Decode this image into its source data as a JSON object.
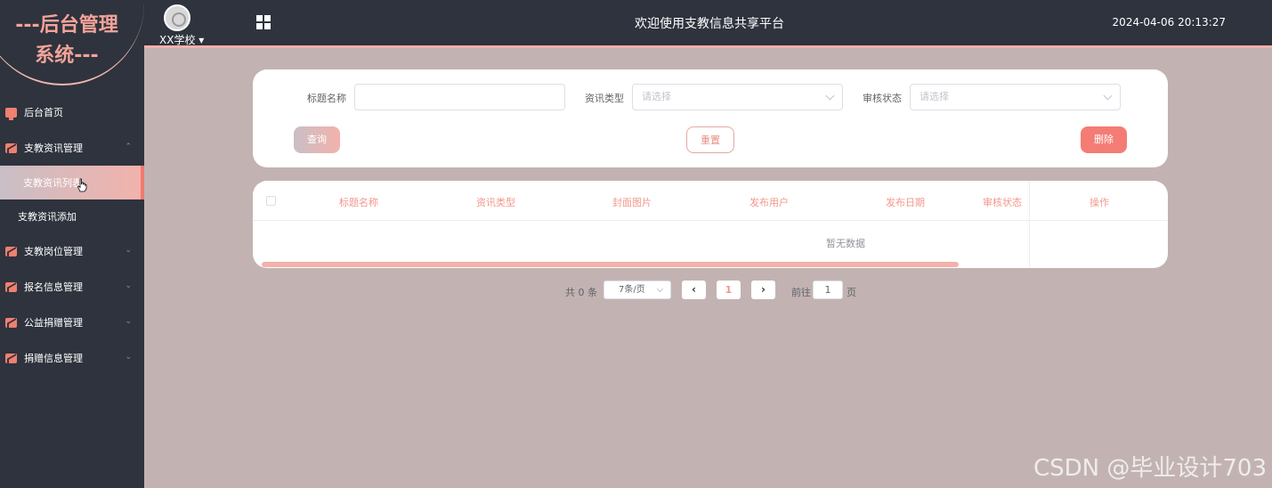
{
  "sidebar": {
    "logo_line1": "---后台管理",
    "logo_line2": "系统---",
    "items": [
      {
        "label": "后台首页"
      },
      {
        "label": "支教资讯管理"
      },
      {
        "label": "支教资讯列表"
      },
      {
        "label": "支教资讯添加"
      },
      {
        "label": "支教岗位管理"
      },
      {
        "label": "报名信息管理"
      },
      {
        "label": "公益捐赠管理"
      },
      {
        "label": "捐赠信息管理"
      }
    ]
  },
  "header": {
    "school": "XX学校 ▾",
    "title": "欢迎使用支教信息共享平台",
    "datetime": "2024-04-06 20:13:27"
  },
  "search": {
    "title_label": "标题名称",
    "title_value": "",
    "type_label": "资讯类型",
    "type_placeholder": "请选择",
    "status_label": "审核状态",
    "status_placeholder": "请选择",
    "query_button": "查询",
    "reset_button": "重置",
    "delete_button": "删除"
  },
  "table": {
    "columns": [
      "标题名称",
      "资讯类型",
      "封面图片",
      "发布用户",
      "发布日期",
      "审核状态",
      "操作"
    ],
    "empty_text": "暂无数据"
  },
  "pagination": {
    "total": "共 0 条",
    "page_size": "7条/页",
    "prev": "‹",
    "current_page": "1",
    "next": "›",
    "goto_label": "前往",
    "goto_value": "1",
    "page_unit": "页"
  },
  "watermark": "CSDN @毕业设计703",
  "colors": {
    "sidebar_bg": "#2e333d",
    "content_bg": "#c2b3b2",
    "accent": "#f3b2ab",
    "accent_text": "#f2978c",
    "delete_button": "#f47c74"
  }
}
